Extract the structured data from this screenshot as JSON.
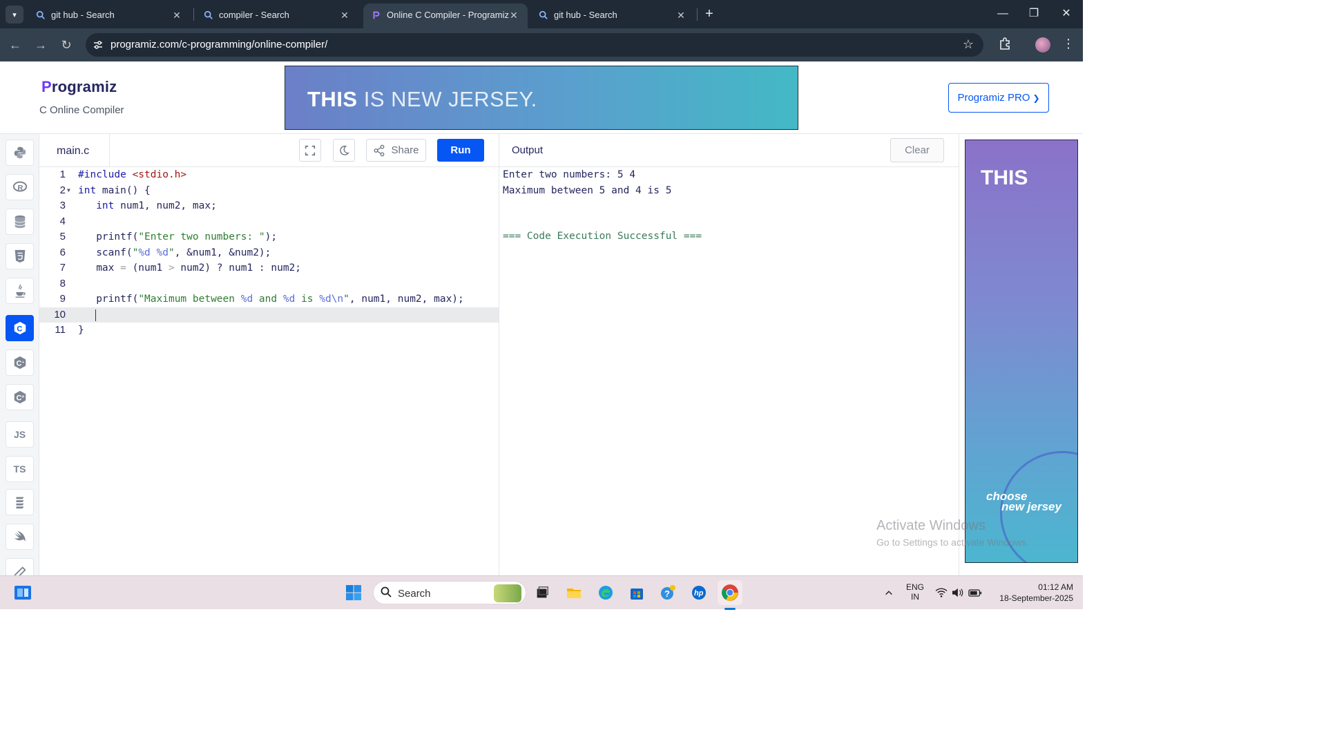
{
  "browser": {
    "tabs": [
      {
        "title": "git hub - Search",
        "active": false,
        "icon": "search-icon"
      },
      {
        "title": "compiler - Search",
        "active": false,
        "icon": "search-icon"
      },
      {
        "title": "Online C Compiler - Programiz",
        "active": true,
        "icon": "programiz-icon"
      },
      {
        "title": "git hub - Search",
        "active": false,
        "icon": "search-icon"
      }
    ],
    "url": "programiz.com/c-programming/online-compiler/"
  },
  "site": {
    "logo": "rogramiz",
    "logo_initial": "P",
    "subtitle": "C Online Compiler",
    "banner_bold": "THIS",
    "banner_rest": " IS NEW JERSEY.",
    "pro_label": "Programiz PRO",
    "pro_chevron": "❯"
  },
  "sidebar": {
    "items": [
      {
        "name": "python",
        "label": "",
        "active": false
      },
      {
        "name": "r",
        "label": "",
        "active": false
      },
      {
        "name": "sql",
        "label": "",
        "active": false
      },
      {
        "name": "html",
        "label": "",
        "active": false
      },
      {
        "name": "java",
        "label": "",
        "active": false
      },
      {
        "name": "c",
        "label": "",
        "active": true
      },
      {
        "name": "cpp",
        "label": "",
        "active": false
      },
      {
        "name": "csharp",
        "label": "",
        "active": false
      },
      {
        "name": "js",
        "label": "JS",
        "active": false
      },
      {
        "name": "ts",
        "label": "TS",
        "active": false
      },
      {
        "name": "go",
        "label": "",
        "active": false
      },
      {
        "name": "swift",
        "label": "",
        "active": false
      },
      {
        "name": "rust",
        "label": "",
        "active": false
      }
    ]
  },
  "editor": {
    "file_name": "main.c",
    "share_label": "Share",
    "run_label": "Run",
    "current_line": 10,
    "lines": [
      "1",
      "2",
      "3",
      "4",
      "5",
      "6",
      "7",
      "8",
      "9",
      "10",
      "11"
    ]
  },
  "output": {
    "title": "Output",
    "clear_label": "Clear",
    "lines": [
      "Enter two numbers: 5 4",
      "Maximum between 5 and 4 is 5",
      "",
      "=== Code Execution Successful ==="
    ]
  },
  "ad": {
    "title": "THIS",
    "brand_line1": "choose",
    "brand_line2": "new jersey"
  },
  "watermark": {
    "line1": "Activate Windows",
    "line2": "Go to Settings to activate Windows."
  },
  "taskbar": {
    "search_placeholder": "Search",
    "lang_line1": "ENG",
    "lang_line2": "IN",
    "time": "01:12 AM",
    "date": "18-September-2025"
  },
  "colors": {
    "accent": "#0556f3",
    "chrome_dark": "#202a36",
    "chrome_mid": "#33404e"
  }
}
